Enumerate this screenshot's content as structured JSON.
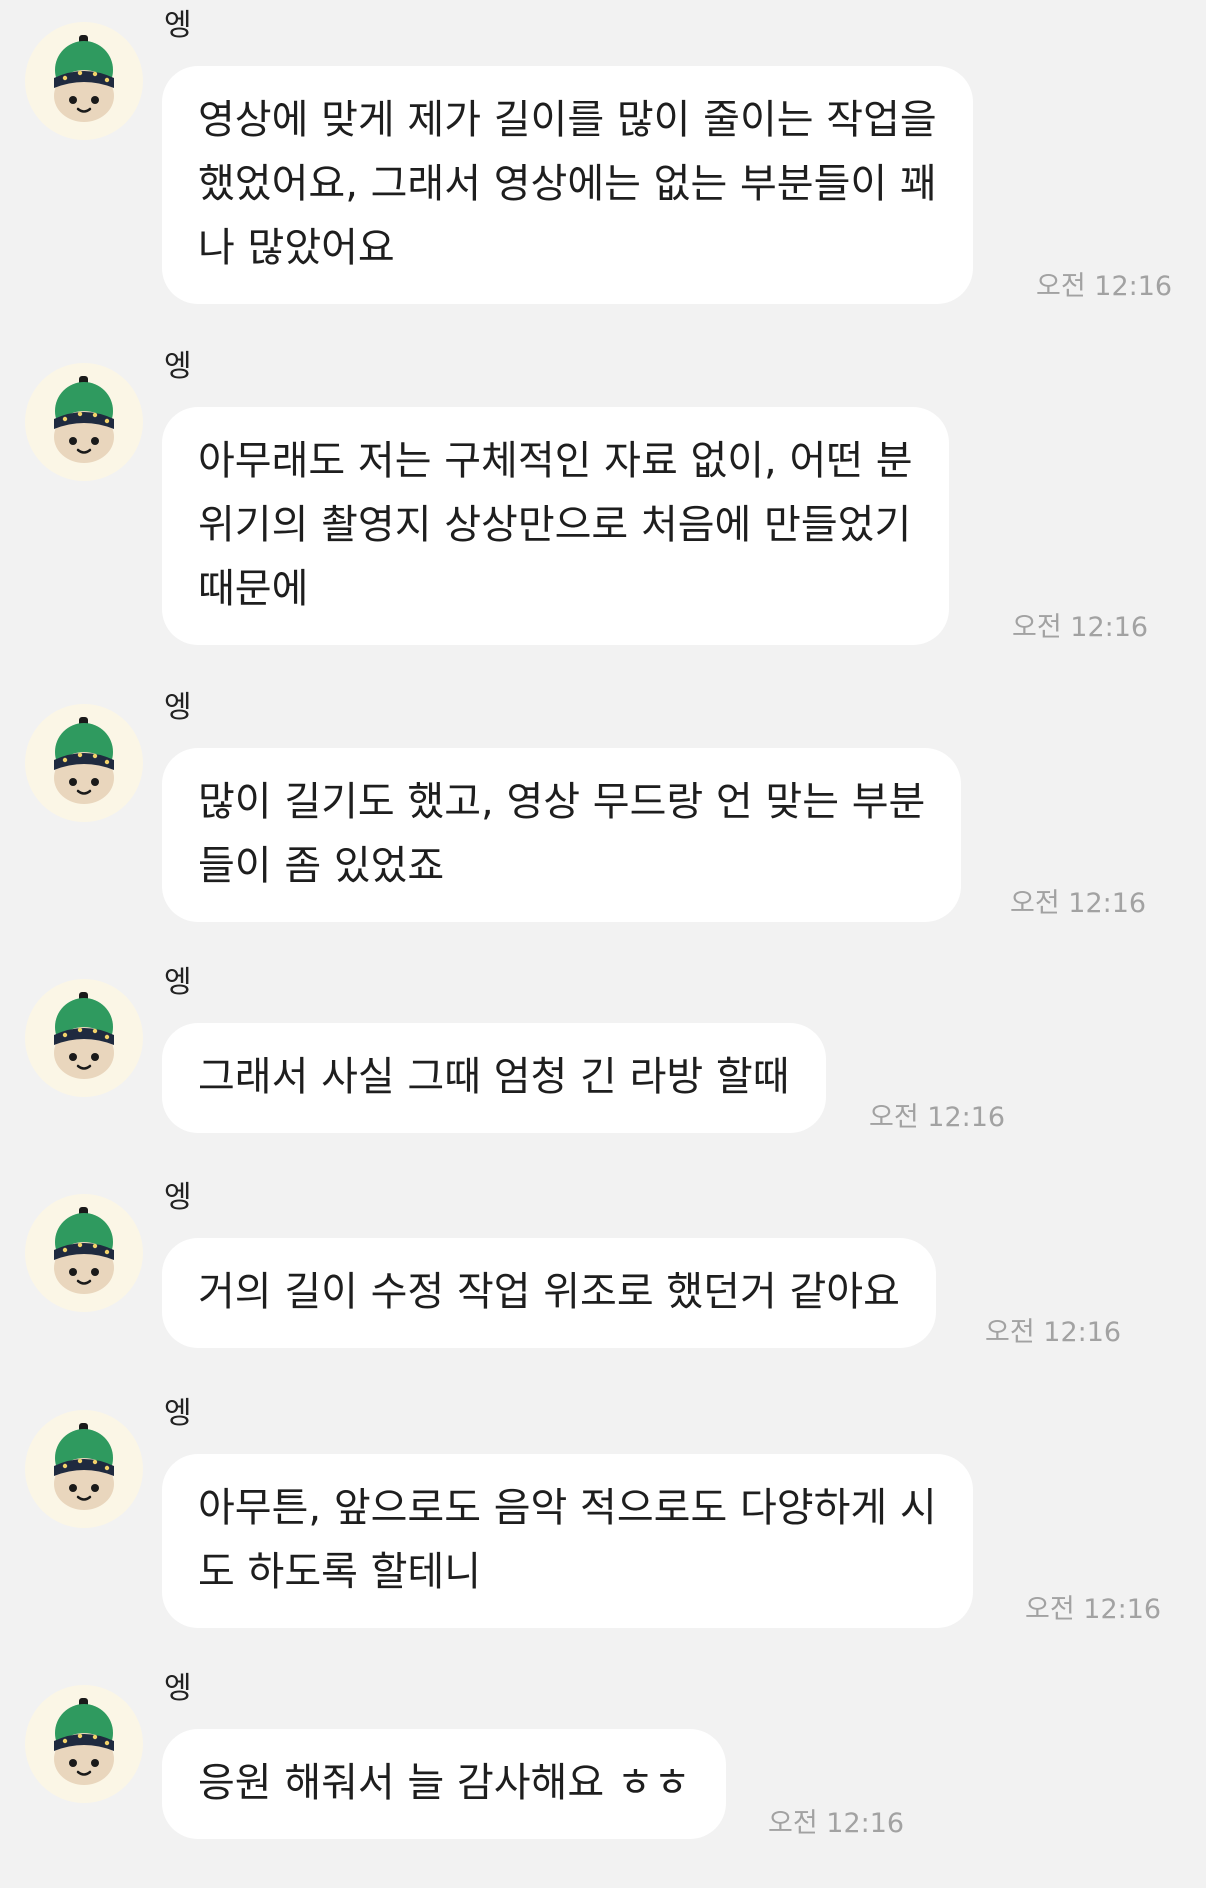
{
  "messages": [
    {
      "sender": "엥",
      "avatar": "plush-mascot-avatar",
      "text": "영상에 맞게 제가 길이를 많이 줄이는 작업을\n했었어요, 그래서 영상에는 없는 부분들이 꽤\n나 많았어요",
      "time": "오전 12:16"
    },
    {
      "sender": "엥",
      "avatar": "plush-mascot-avatar",
      "text": "아무래도 저는 구체적인 자료 없이, 어떤 분\n위기의 촬영지 상상만으로 처음에 만들었기\n때문에",
      "time": "오전 12:16"
    },
    {
      "sender": "엥",
      "avatar": "plush-mascot-avatar",
      "text": "많이 길기도 했고, 영상 무드랑 언 맞는 부분\n들이 좀 있었죠",
      "time": "오전 12:16"
    },
    {
      "sender": "엥",
      "avatar": "plush-mascot-avatar",
      "text": "그래서 사실 그때 엄청 긴 라방 할때",
      "time": "오전 12:16"
    },
    {
      "sender": "엥",
      "avatar": "plush-mascot-avatar",
      "text": "거의 길이 수정 작업 위조로 했던거 같아요",
      "time": "오전 12:16"
    },
    {
      "sender": "엥",
      "avatar": "plush-mascot-avatar",
      "text": "아무튼, 앞으로도 음악 적으로도 다양하게 시\n도 하도록 할테니",
      "time": "오전 12:16"
    },
    {
      "sender": "엥",
      "avatar": "plush-mascot-avatar",
      "text": "응원 해줘서 늘 감사해요 ㅎㅎ",
      "time": "오전 12:16"
    }
  ]
}
